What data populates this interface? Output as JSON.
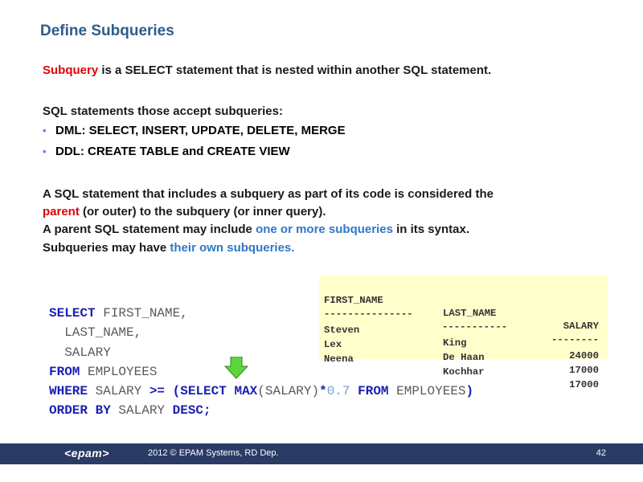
{
  "title": "Define Subqueries",
  "intro": {
    "highlight": "Subquery",
    "rest": " is a SELECT statement that is nested within another SQL statement."
  },
  "accept_heading": "SQL statements those accept subqueries:",
  "bullets": [
    "DML: SELECT, INSERT, UPDATE, DELETE, MERGE",
    "DDL: CREATE TABLE and CREATE VIEW"
  ],
  "parent_para": {
    "line1": "A SQL statement that includes a subquery as part of its code is considered the",
    "highlight": "parent",
    "line2_rest": " (or outer) to the subquery (or inner query)."
  },
  "multi_para": {
    "before": "A parent SQL statement may include ",
    "highlight": "one or more subqueries",
    "after": " in its syntax."
  },
  "own_para": {
    "before": "Subqueries may have ",
    "highlight": "their own subqueries."
  },
  "result_table": {
    "headers": [
      "FIRST_NAME",
      "LAST_NAME",
      "SALARY"
    ],
    "separators": [
      "---------------",
      "-----------",
      "--------"
    ],
    "rows": [
      [
        "Steven",
        "King",
        "24000"
      ],
      [
        "Lex",
        "De Haan",
        "17000"
      ],
      [
        "Neena",
        "Kochhar",
        "17000"
      ]
    ]
  },
  "sql": {
    "l1_kw": "SELECT",
    "l1_rest": " FIRST_NAME,",
    "l2": "  LAST_NAME,",
    "l3": "  SALARY",
    "l4_kw": "FROM",
    "l4_rest": " EMPLOYEES",
    "l5_kw": "WHERE",
    "l5_a": " SALARY ",
    "l5_op": ">=",
    "l5_b": " ",
    "l5_paren": "(",
    "l5_kw2": "SELECT MAX",
    "l5_c": "(SALARY)",
    "l5_star": "*",
    "l5_num": "0.7",
    "l5_d": " ",
    "l5_kw3": "FROM",
    "l5_e": " EMPLOYEES",
    "l5_close": ")",
    "l6_kw": "ORDER BY",
    "l6_rest": " SALARY ",
    "l6_kw2": "DESC;"
  },
  "colors": {
    "title": "#2e5c8a",
    "highlight_red": "#e0000a",
    "highlight_blue": "#2f78c5",
    "sql_keyword": "#1a1fb0",
    "result_bg": "#ffffcc",
    "arrow": "#5cd63a",
    "footer_bg": "#2a3b66"
  },
  "icons": {
    "arrow": "down-arrow-icon"
  },
  "footer": {
    "logo": "<epam>",
    "copyright": "2012 © EPAM Systems, RD Dep.",
    "page_number": "42"
  }
}
